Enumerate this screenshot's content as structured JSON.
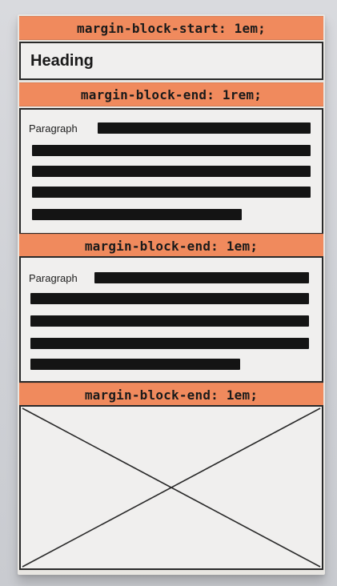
{
  "labels": {
    "margin_block_start": "margin-block-start: 1em;",
    "margin_block_end_rem": "margin-block-end: 1rem;",
    "margin_block_end_em_1": "margin-block-end: 1em;",
    "margin_block_end_em_2": "margin-block-end: 1em;"
  },
  "heading": "Heading",
  "paragraphs": [
    {
      "label": "Paragraph"
    },
    {
      "label": "Paragraph"
    }
  ],
  "colors": {
    "orange": "#f08a5d",
    "ink": "#141414",
    "paper": "#f0efee",
    "background": "#d6d7db"
  },
  "image_placeholder": {
    "icon": "x-placeholder-icon"
  }
}
